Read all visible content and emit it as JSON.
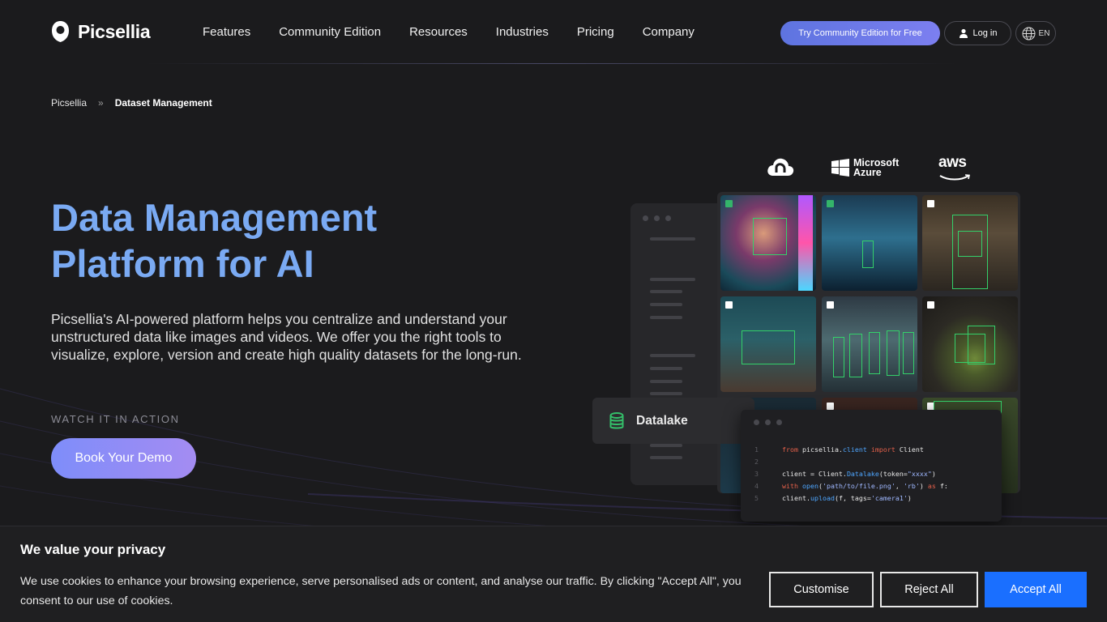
{
  "header": {
    "logo_text": "Picsellia",
    "nav": [
      {
        "label": "Features"
      },
      {
        "label": "Community Edition"
      },
      {
        "label": "Resources"
      },
      {
        "label": "Industries"
      },
      {
        "label": "Pricing"
      },
      {
        "label": "Company"
      }
    ],
    "cta_label": "Try Community Edition for Free",
    "login_label": "Log in",
    "lang_label": "EN"
  },
  "breadcrumb": {
    "home": "Picsellia",
    "separator": "»",
    "current": "Dataset Management"
  },
  "hero": {
    "title_line1": "Data Management",
    "title_line2": "Platform for AI",
    "description": "Picsellia's AI-powered platform helps you centralize and understand your unstructured data like images and videos. We offer you the right tools to visualize, explore, version and create high quality datasets for the long-run.",
    "watch_label": "WATCH IT IN ACTION",
    "demo_button": "Book Your Demo"
  },
  "illustration": {
    "cloud_logos": [
      {
        "icon": "google-cloud-icon"
      },
      {
        "icon": "microsoft-azure-logo",
        "line1": "Microsoft",
        "line2": "Azure"
      },
      {
        "icon": "aws-logo",
        "text": "aws"
      }
    ],
    "datalake_label": "Datalake",
    "code_lines": [
      {
        "num": "1",
        "text": "from picsellia.client import Client"
      },
      {
        "num": "2",
        "text": ""
      },
      {
        "num": "3",
        "text": "client = Client.Datalake(token=\"xxxx\")"
      },
      {
        "num": "4",
        "text": "with open('path/to/file.png', 'rb') as f:"
      },
      {
        "num": "5",
        "text": "client.upload(f, tags='camera1')"
      }
    ]
  },
  "cookie_banner": {
    "title": "We value your privacy",
    "text": "We use cookies to enhance your browsing experience, serve personalised ads or content, and analyse our traffic. By clicking \"Accept All\", you consent to our use of cookies.",
    "customise_label": "Customise",
    "reject_label": "Reject All",
    "accept_label": "Accept All"
  },
  "colors": {
    "background": "#1b1b1d",
    "title_blue": "#7aaaf3",
    "accept_blue": "#1a6fff",
    "cta_gradient_start": "#5e74e0",
    "detection_green": "#34d06a"
  }
}
